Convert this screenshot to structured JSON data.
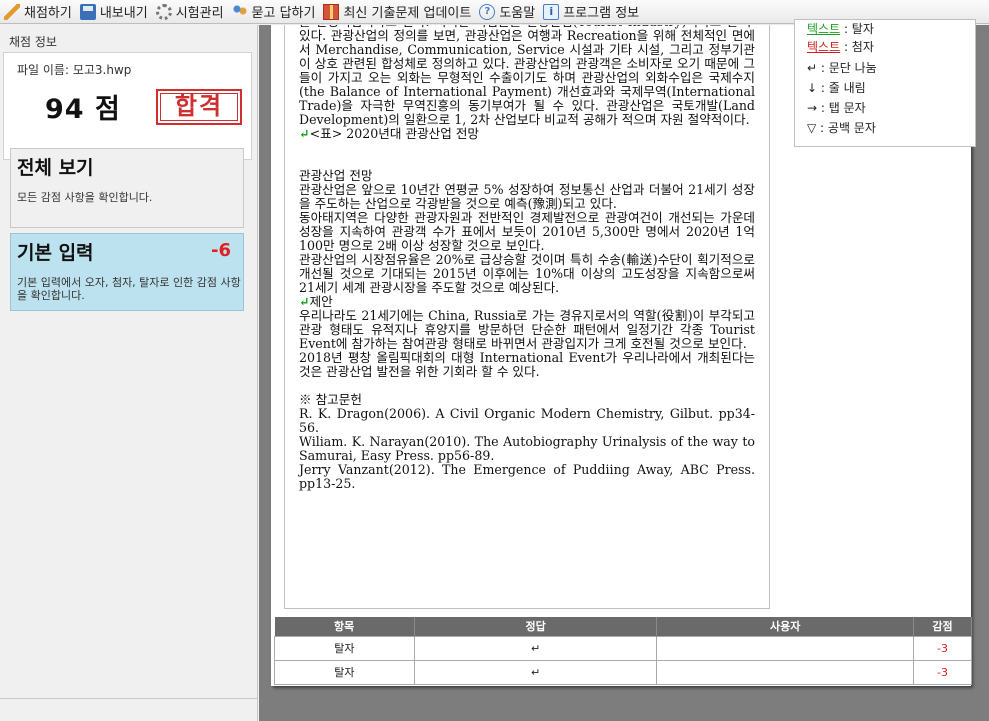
{
  "toolbar": {
    "items": [
      {
        "label": "채점하기",
        "icon": "pencil-icon"
      },
      {
        "label": "내보내기",
        "icon": "save-icon"
      },
      {
        "label": "시험관리",
        "icon": "gear-icon"
      },
      {
        "label": "묻고 답하기",
        "icon": "people-icon"
      },
      {
        "label": "최신 기출문제 업데이트",
        "icon": "gift-icon"
      },
      {
        "label": "도움말",
        "icon": "help-icon"
      },
      {
        "label": "프로그램 정보",
        "icon": "info-icon"
      }
    ]
  },
  "left": {
    "section_title": "채점 정보",
    "file_label": "파일 이름: 모고3.hwp",
    "score": "94 점",
    "result_stamp": "합격",
    "overview": {
      "title": "전체 보기",
      "desc": "모든 감점 사항을 확인합니다."
    },
    "basic": {
      "title": "기본 입력",
      "deduction": "-6",
      "desc": "기본 입력에서 오자, 첨자, 탈자로 인한 감점 사항을 확인합니다."
    }
  },
  "document": {
    "p1": "을 관광기업이라고 한다. 이러한 기업들을 관광산업(Tourist Industry)이라고 할 수 있다. 관광산업의 정의를 보면, 관광산업은 여행과 Recreation을 위해 전체적인 면에서 Merchandise, Communication, Service 시설과 기타 시설, 그리고 정부기관이 상호 관련된 합성체로 정의하고 있다. 관광산업의 관광객은 소비자로 오기 때문에 그들이 가지고 오는 외화는 무형적인 수출이기도 하며 관광산업의 외화수입은 국제수지(the Balance of International Payment) 개선효과와 국제무역(International Trade)을 자극한 무역진흥의 동기부여가 될 수 있다. 관광산업은 국토개발(Land Development)의 일환으로 1, 2차 산업보다 비교적 공해가 적으며 자원 절약적이다.",
    "table_caption": "<표> 2020년대 관광산업 전망",
    "h_outlook": "관광산업 전망",
    "p2": "관광산업은 앞으로 10년간 연평균 5% 성장하여 정보통신 산업과 더불어 21세기 성장을 주도하는 산업으로 각광받을 것으로 예측(豫測)되고 있다.",
    "p3": "동아태지역은 다양한 관광자원과 전반적인 경제발전으로 관광여건이 개선되는 가운데 성장을 지속하여 관광객 수가 표에서 보듯이 2010년 5,300만 명에서 2020년 1억100만 명으로 2배 이상 성장할 것으로 보인다.",
    "p4": "관광산업의 시장점유율은 20%로 급상승할 것이며 특히 수송(輸送)수단이 획기적으로 개선될 것으로 기대되는 2015년 이후에는 10%대 이상의 고도성장을 지속함으로써 21세기 세계 관광시장을 주도할 것으로 예상된다.",
    "h_proposal": "제안",
    "p5": "우리나라도 21세기에는 China, Russia로 가는 경유지로서의 역할(役割)이 부각되고 관광 형태도 유적지나 휴양지를 방문하던 단순한 패턴에서 일정기간 각종 Tourist Event에 참가하는 참여관광 형태로 바뀌면서 관광입지가 크게 호전될 것으로 보인다.",
    "p6": "2018년 평창 올림픽대회의 대형 International Event가 우리나라에서 개최된다는 것은 관광산업 발전을 위한 기회라 할 수 있다.",
    "refs_title": "※ 참고문헌",
    "ref1": "R. K. Dragon(2006). A Civil Organic Modern Chemistry, Gilbut. pp34-56.",
    "ref2": "Wiliam. K. Narayan(2010). The Autobiography Urinalysis of the way to Samurai, Easy Press. pp56-89.",
    "ref3": "Jerry Vanzant(2012). The Emergence of Puddiing Away, ABC Press. pp13-25.",
    "para_mark": "↵"
  },
  "legend": {
    "items": [
      {
        "symbol": "텍스트",
        "desc": " : 탈자",
        "color": "#20a020"
      },
      {
        "symbol": "텍스트",
        "desc": " : 첨자",
        "color": "#d02020"
      },
      {
        "symbol": "↵",
        "desc": " : 문단 나눔"
      },
      {
        "symbol": "↓",
        "desc": " : 줄 내림"
      },
      {
        "symbol": "→",
        "desc": " : 탭 문자"
      },
      {
        "symbol": "▽",
        "desc": " : 공백 문자"
      }
    ]
  },
  "table": {
    "headers": [
      "항목",
      "정답",
      "사용자",
      "감점"
    ],
    "rows": [
      {
        "item": "탈자",
        "answer": "↵",
        "user": "",
        "score": "-3"
      },
      {
        "item": "탈자",
        "answer": "↵",
        "user": "",
        "score": "-3"
      }
    ]
  }
}
